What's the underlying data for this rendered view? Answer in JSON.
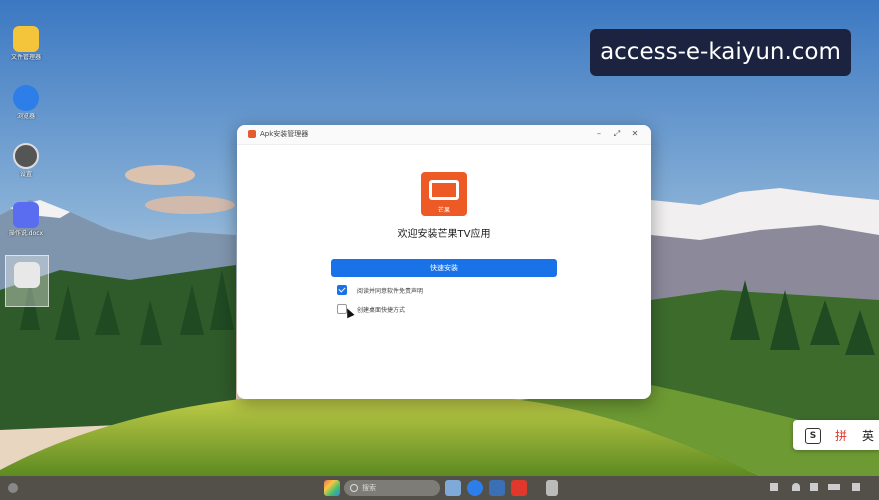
{
  "watermark": "access-e-kaiyun.com",
  "desktop": {
    "icons": [
      {
        "label": "文件管理器",
        "icon": "folder-icon"
      },
      {
        "label": "浏览器",
        "icon": "browser-icon"
      },
      {
        "label": "设置",
        "icon": "settings-icon"
      },
      {
        "label": "操作说.docx",
        "icon": "docx-icon"
      },
      {
        "label": "",
        "icon": "image-file-icon"
      }
    ]
  },
  "dialog": {
    "title": "Apk安装管理器",
    "app_icon_text": "芒果",
    "welcome": "欢迎安装芒果TV应用",
    "install_button": "快速安装",
    "checkbox_agree": "阅读并同意软件免责声明",
    "checkbox_agree_checked": true,
    "checkbox_shortcut": "创建桌面快捷方式",
    "checkbox_shortcut_checked": false
  },
  "ime": {
    "sogou": "S",
    "pinyin": "拼",
    "english": "英"
  },
  "taskbar": {
    "search_placeholder": "搜索"
  },
  "colors": {
    "accent": "#1a72e8",
    "app_brand": "#ee5a25",
    "watermark_bg": "#1c2340"
  }
}
